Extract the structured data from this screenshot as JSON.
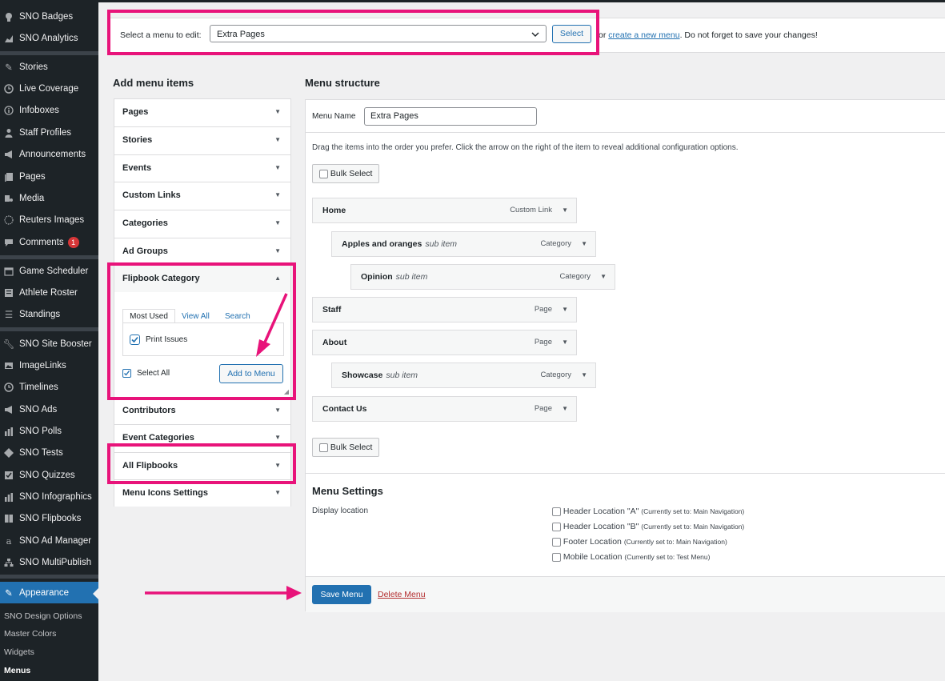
{
  "sidebar": {
    "items": [
      {
        "icon": "badge-icon",
        "label": "SNO Badges"
      },
      {
        "icon": "analytics-icon",
        "label": "SNO Analytics"
      },
      {
        "icon": "pin-icon",
        "label": "Stories"
      },
      {
        "icon": "clock-icon",
        "label": "Live Coverage"
      },
      {
        "icon": "info-icon",
        "label": "Infoboxes"
      },
      {
        "icon": "user-icon",
        "label": "Staff Profiles"
      },
      {
        "icon": "megaphone-icon",
        "label": "Announcements"
      },
      {
        "icon": "pages-icon",
        "label": "Pages"
      },
      {
        "icon": "media-icon",
        "label": "Media"
      },
      {
        "icon": "reuters-icon",
        "label": "Reuters Images"
      },
      {
        "icon": "comment-icon",
        "label": "Comments",
        "badge": "1"
      },
      {
        "icon": "calendar-icon",
        "label": "Game Scheduler"
      },
      {
        "icon": "roster-icon",
        "label": "Athlete Roster"
      },
      {
        "icon": "list-icon",
        "label": "Standings"
      },
      {
        "icon": "wrench-icon",
        "label": "SNO Site Booster"
      },
      {
        "icon": "image-icon",
        "label": "ImageLinks"
      },
      {
        "icon": "clock-icon",
        "label": "Timelines"
      },
      {
        "icon": "megaphone-icon",
        "label": "SNO Ads"
      },
      {
        "icon": "chart-icon",
        "label": "SNO Polls"
      },
      {
        "icon": "diamond-icon",
        "label": "SNO Tests"
      },
      {
        "icon": "quiz-icon",
        "label": "SNO Quizzes"
      },
      {
        "icon": "chart-icon",
        "label": "SNO Infographics"
      },
      {
        "icon": "book-icon",
        "label": "SNO Flipbooks"
      },
      {
        "icon": "amazon-icon",
        "label": "SNO Ad Manager"
      },
      {
        "icon": "network-icon",
        "label": "SNO MultiPublish"
      }
    ],
    "appearance": {
      "icon": "brush-icon",
      "label": "Appearance"
    },
    "sub_items": [
      "SNO Design Options",
      "Master Colors",
      "Widgets",
      "Menus"
    ]
  },
  "menu_select": {
    "label": "Select a menu to edit:",
    "selected": "Extra Pages",
    "select_button": "Select",
    "after_prefix": "or",
    "create_link": "create a new menu",
    "after_suffix": ". Do not forget to save your changes!"
  },
  "add_items": {
    "title": "Add menu items",
    "sections": [
      "Pages",
      "Stories",
      "Events",
      "Custom Links",
      "Categories",
      "Ad Groups"
    ],
    "flipbook": {
      "title": "Flipbook Category",
      "tabs": [
        "Most Used",
        "View All",
        "Search"
      ],
      "item": "Print Issues",
      "select_all": "Select All",
      "add_button": "Add to Menu"
    },
    "sections_after": [
      "Contributors",
      "Event Categories",
      "All Flipbooks",
      "Menu Icons Settings"
    ]
  },
  "structure": {
    "title": "Menu structure",
    "menu_name_label": "Menu Name",
    "menu_name_value": "Extra Pages",
    "instructions": "Drag the items into the order you prefer. Click the arrow on the right of the item to reveal additional configuration options.",
    "bulk_select": "Bulk Select",
    "items": [
      {
        "title": "Home",
        "sub": "",
        "type": "Custom Link"
      },
      {
        "title": "Apples and oranges",
        "sub": "sub item",
        "type": "Category"
      },
      {
        "title": "Opinion",
        "sub": "sub item",
        "type": "Category"
      },
      {
        "title": "Staff",
        "sub": "",
        "type": "Page"
      },
      {
        "title": "About",
        "sub": "",
        "type": "Page"
      },
      {
        "title": "Showcase",
        "sub": "sub item",
        "type": "Category"
      },
      {
        "title": "Contact Us",
        "sub": "",
        "type": "Page"
      }
    ],
    "settings_title": "Menu Settings",
    "display_location_label": "Display location",
    "locations": [
      {
        "name": "Header Location \"A\"",
        "note": "(Currently set to: Main Navigation)"
      },
      {
        "name": "Header Location \"B\"",
        "note": "(Currently set to: Main Navigation)"
      },
      {
        "name": "Footer Location",
        "note": "(Currently set to: Main Navigation)"
      },
      {
        "name": "Mobile Location",
        "note": "(Currently set to: Test Menu)"
      }
    ],
    "save_button": "Save Menu",
    "delete_link": "Delete Menu"
  },
  "colors": {
    "highlight": "#e8137a",
    "primary": "#2271b1",
    "sidebar_bg": "#1d2327"
  }
}
